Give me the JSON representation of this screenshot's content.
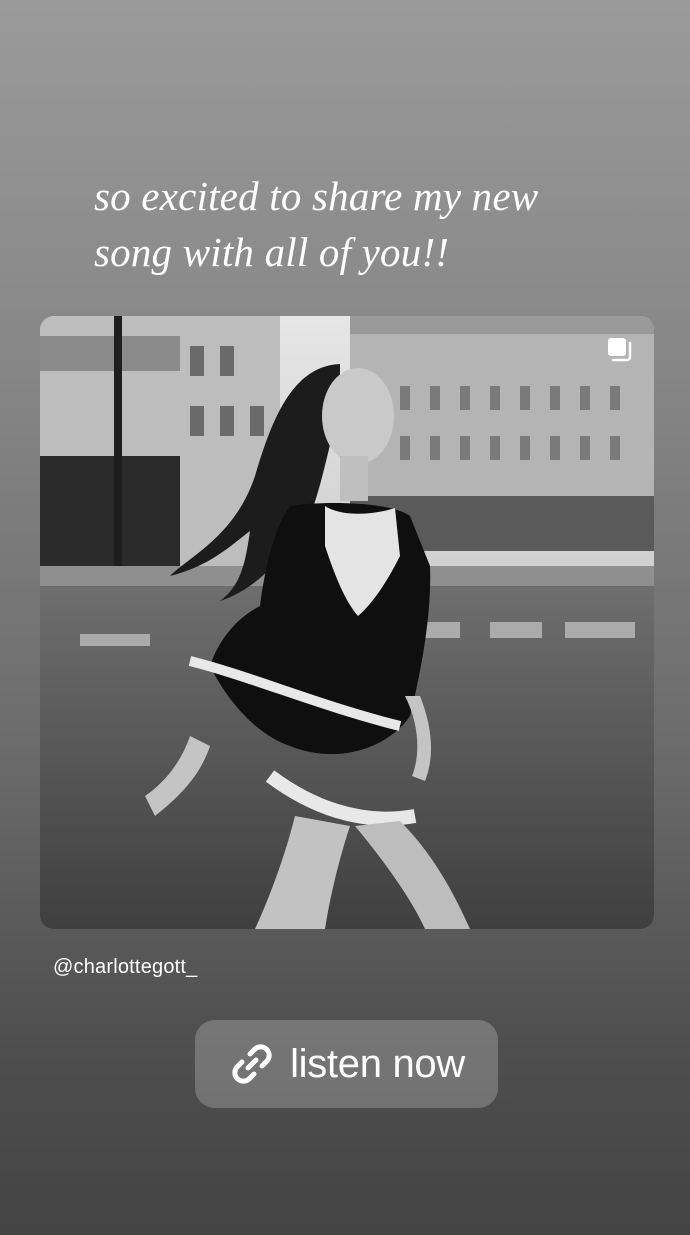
{
  "story": {
    "caption_line1": "so excited to share my new",
    "caption_line2": "song with all of you!!",
    "username": "@charlottegott_",
    "link_label": "listen now",
    "icons": {
      "multi_image": "multiple-images-icon",
      "link": "link-icon"
    },
    "colors": {
      "text": "#ffffff",
      "sticker_bg": "rgba(255,255,255,0.22)"
    }
  }
}
